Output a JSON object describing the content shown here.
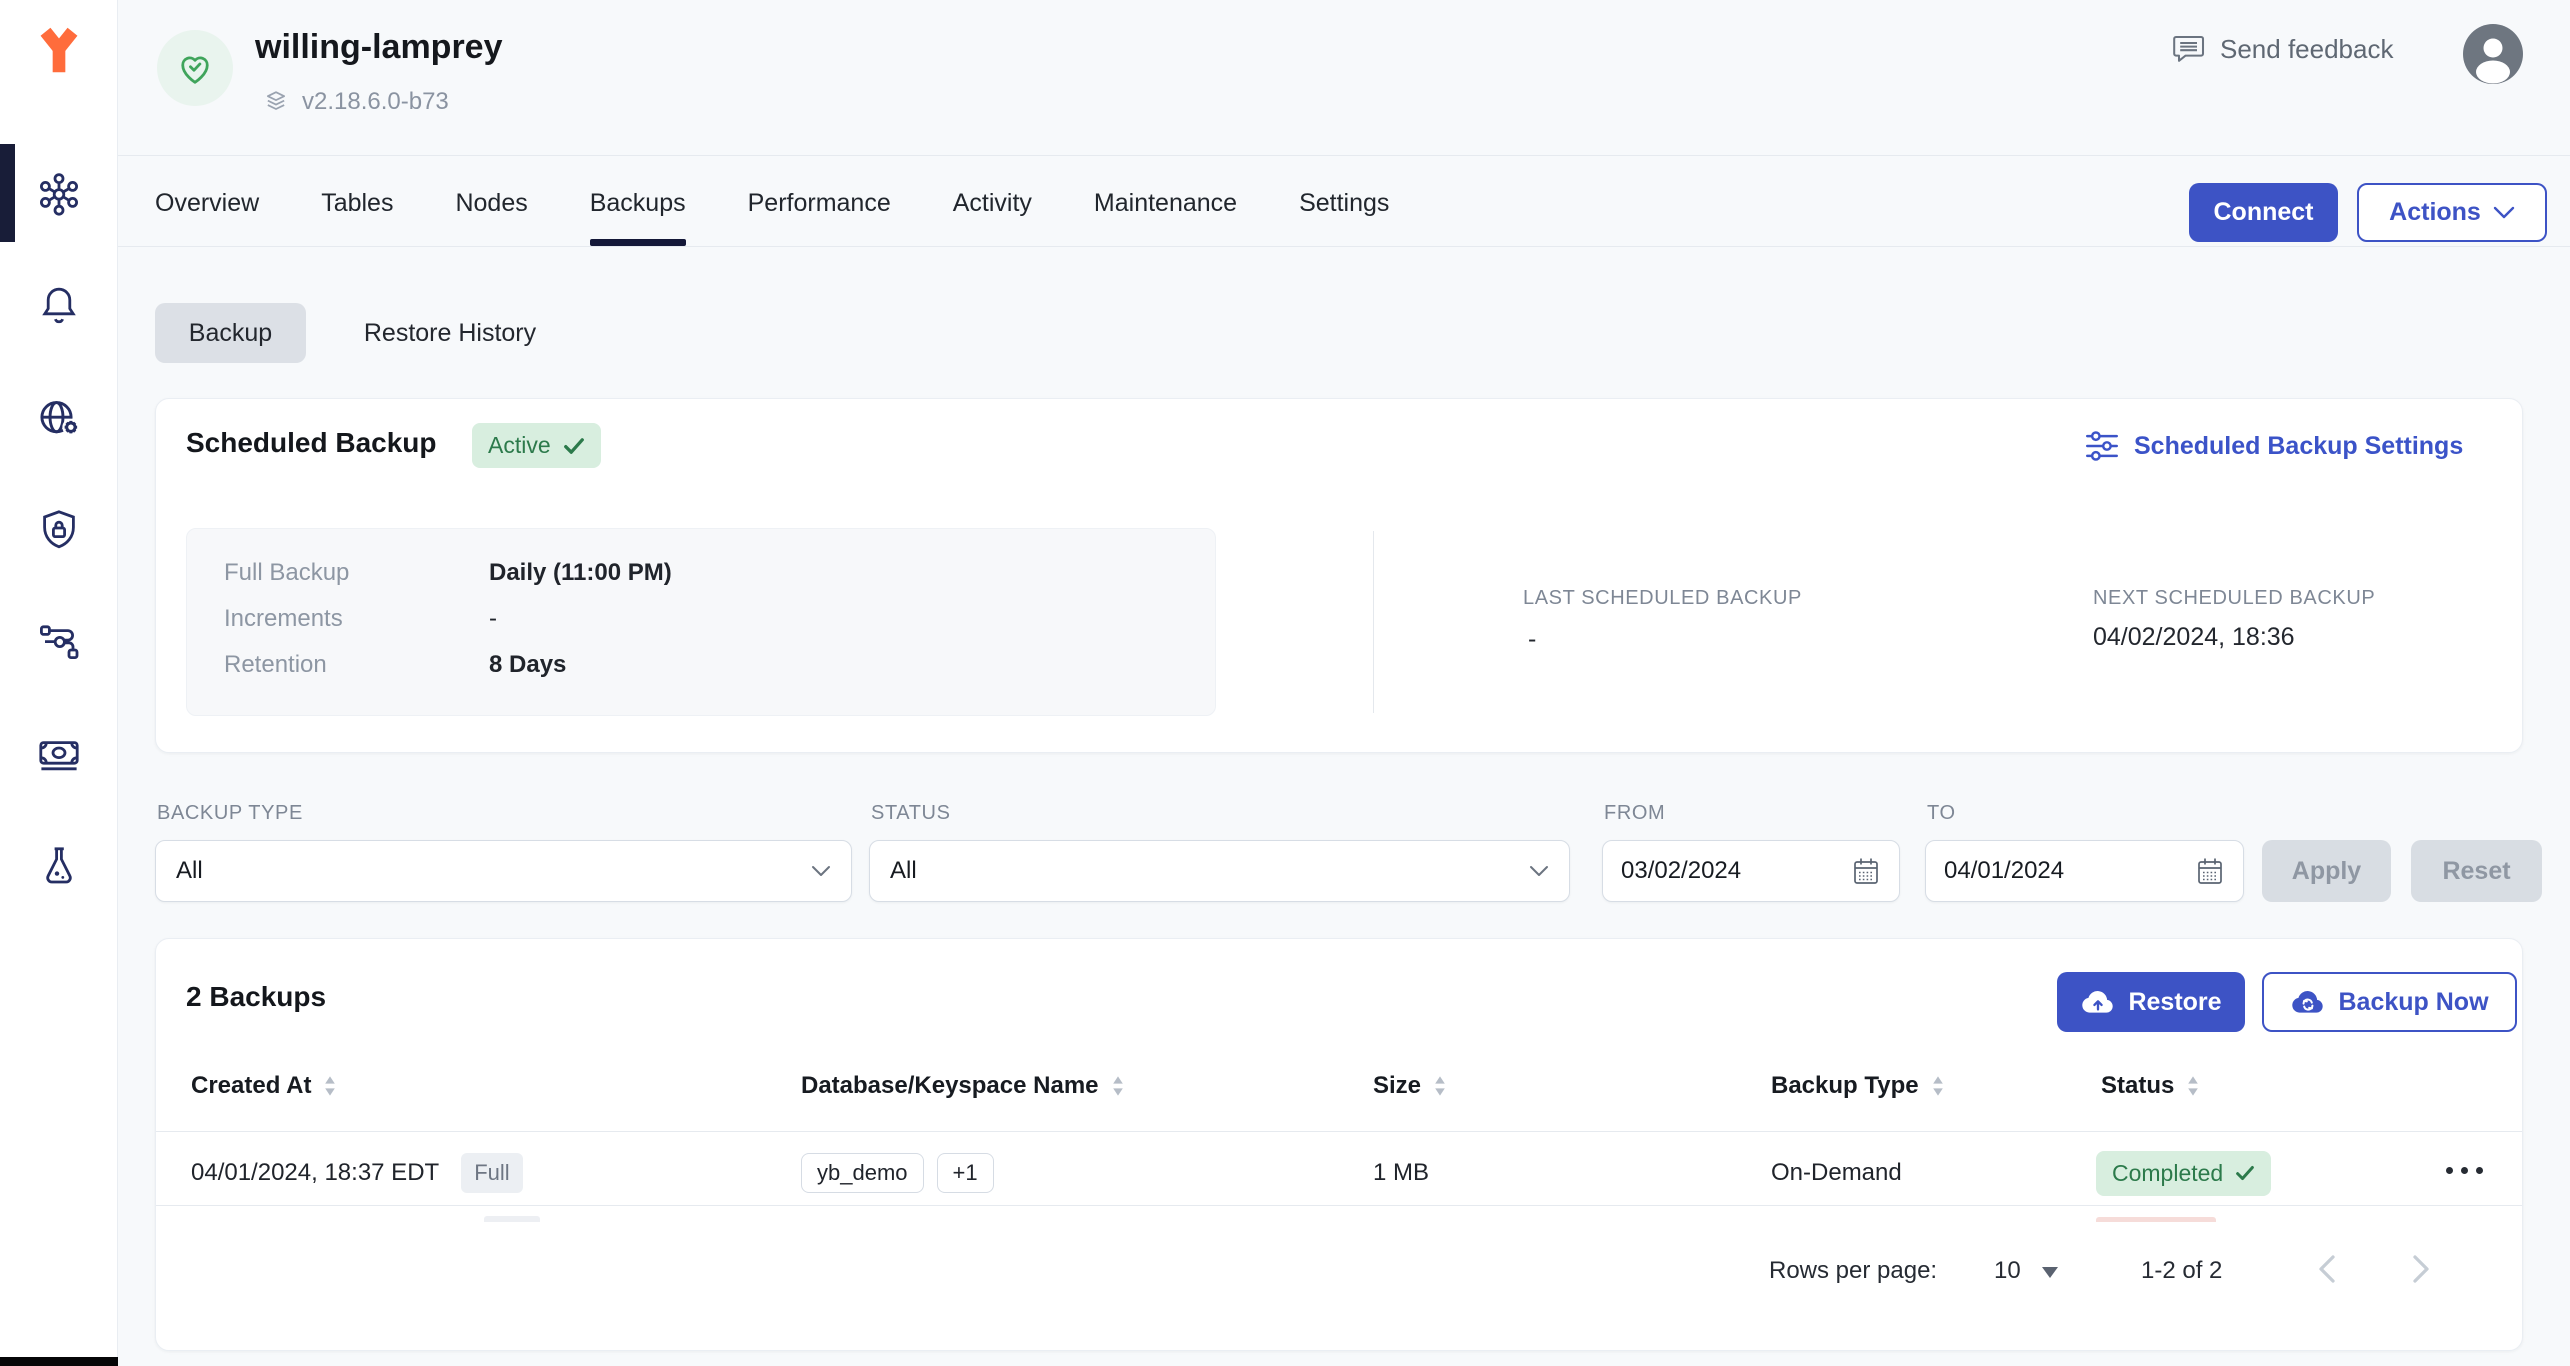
{
  "header": {
    "cluster_name": "willing-lamprey",
    "version": "v2.18.6.0-b73",
    "send_feedback_label": "Send feedback"
  },
  "nav": {
    "tabs": [
      {
        "label": "Overview"
      },
      {
        "label": "Tables"
      },
      {
        "label": "Nodes"
      },
      {
        "label": "Backups"
      },
      {
        "label": "Performance"
      },
      {
        "label": "Activity"
      },
      {
        "label": "Maintenance"
      },
      {
        "label": "Settings"
      }
    ],
    "connect_label": "Connect",
    "actions_label": "Actions"
  },
  "view_toggle": {
    "backup_label": "Backup",
    "restore_history_label": "Restore History"
  },
  "scheduled": {
    "title": "Scheduled Backup",
    "status": "Active",
    "settings_link": "Scheduled Backup Settings",
    "rows": [
      {
        "label": "Full Backup",
        "value": "Daily (11:00 PM)"
      },
      {
        "label": "Increments",
        "value": "-"
      },
      {
        "label": "Retention",
        "value": "8 Days"
      }
    ],
    "last_label": "LAST SCHEDULED BACKUP",
    "last_value": "-",
    "next_label": "NEXT SCHEDULED BACKUP",
    "next_value": "04/02/2024, 18:36"
  },
  "filters": {
    "backup_type_label": "BACKUP TYPE",
    "backup_type_value": "All",
    "status_label": "STATUS",
    "status_value": "All",
    "from_label": "FROM",
    "from_value": "03/02/2024",
    "to_label": "TO",
    "to_value": "04/01/2024",
    "apply_label": "Apply",
    "reset_label": "Reset"
  },
  "backups": {
    "title": "2 Backups",
    "restore_label": "Restore",
    "backup_now_label": "Backup Now",
    "columns": [
      {
        "label": "Created At"
      },
      {
        "label": "Database/Keyspace Name"
      },
      {
        "label": "Size"
      },
      {
        "label": "Backup Type"
      },
      {
        "label": "Status"
      }
    ],
    "rows": [
      {
        "created_at": "04/01/2024, 18:37 EDT",
        "tag": "Full",
        "keyspace": "yb_demo",
        "extra": "+1",
        "size": "1 MB",
        "backup_type": "On-Demand",
        "status": "Completed"
      }
    ],
    "pagination": {
      "rows_per_page_label": "Rows per page:",
      "rows_per_page_value": "10",
      "range_label": "1-2 of 2"
    }
  },
  "sidebar": {
    "icons": [
      "universes-icon",
      "alerts-icon",
      "network-settings-icon",
      "security-icon",
      "integrations-icon",
      "billing-icon",
      "labs-icon"
    ]
  },
  "colors": {
    "brand_orange": "#FF6C3C",
    "primary_blue": "#3D53C5",
    "nav_navy": "#252E63",
    "green_badge_bg": "#D8EEDF",
    "green_text": "#2C7A4B"
  }
}
